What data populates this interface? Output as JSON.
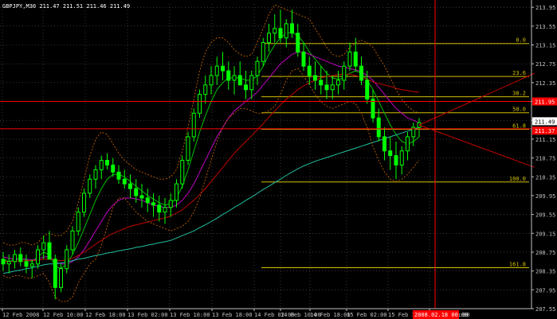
{
  "chart_data": {
    "type": "candlestick",
    "symbol_header": "GBPJPY,M30 211.47 211.51 211.46 211.49",
    "colors": {
      "background": "#000000",
      "grid": "#5a5a5a",
      "axis": "#c0c0c0",
      "candle": "#00ff00",
      "fib": "#d4c000",
      "redline": "#ff0000",
      "ma_green": "#00c000",
      "ma_magenta": "#c000c0",
      "ma_red": "#c00000",
      "ma_teal": "#20c0a0",
      "bollinger": "#c06000"
    },
    "ylim": [
      207.55,
      214.02
    ],
    "y_ticks": [
      "213.95",
      "213.55",
      "213.15",
      "212.75",
      "212.35",
      "211.95",
      "211.55",
      "211.15",
      "210.75",
      "210.35",
      "209.95",
      "209.55",
      "209.15",
      "208.75",
      "208.35",
      "207.95",
      "207.55"
    ],
    "x_ticks": [
      "12 Feb 2008",
      "12 Feb 10:00",
      "12 Feb 18:00",
      "13 Feb 02:00",
      "13 Feb 10:00",
      "13 Feb 18:00",
      "14 Feb 02:00",
      "14 Feb 10:00",
      "14 Feb 18:00",
      "15 Feb 02:00",
      "15 Feb 10:00",
      "15 Feb 18:00"
    ],
    "cursor_time_label": "2008.02.18 00:00",
    "current_price_label": "211.49",
    "red_price_label": "211.95",
    "red_price_label_2": "211.37",
    "fibonacci": {
      "levels": [
        {
          "label": "0.0",
          "price": 213.18
        },
        {
          "label": "23.6",
          "price": 212.48
        },
        {
          "label": "38.2",
          "price": 212.05
        },
        {
          "label": "50.0",
          "price": 211.71
        },
        {
          "label": "61.8",
          "price": 211.36
        },
        {
          "label": "100.0",
          "price": 210.24
        },
        {
          "label": "161.8",
          "price": 208.42
        }
      ]
    },
    "horizontal_lines": [
      211.95,
      211.37
    ],
    "series": [
      {
        "kind": "ohlc",
        "values": [
          [
            208.6,
            208.75,
            208.35,
            208.5
          ],
          [
            208.5,
            208.7,
            208.3,
            208.55
          ],
          [
            208.55,
            208.8,
            208.4,
            208.7
          ],
          [
            208.7,
            208.85,
            208.45,
            208.55
          ],
          [
            208.55,
            208.7,
            208.3,
            208.45
          ],
          [
            208.45,
            208.6,
            208.2,
            208.5
          ],
          [
            208.5,
            208.9,
            208.4,
            208.8
          ],
          [
            208.8,
            209.1,
            208.6,
            208.95
          ],
          [
            208.95,
            209.2,
            208.7,
            208.6
          ],
          [
            208.6,
            208.7,
            207.75,
            208.0
          ],
          [
            208.0,
            208.5,
            207.9,
            208.4
          ],
          [
            208.4,
            208.9,
            208.3,
            208.8
          ],
          [
            208.8,
            209.3,
            208.7,
            209.2
          ],
          [
            209.2,
            209.7,
            209.1,
            209.6
          ],
          [
            209.6,
            210.1,
            209.5,
            210.0
          ],
          [
            210.0,
            210.4,
            209.9,
            210.3
          ],
          [
            210.3,
            210.6,
            210.1,
            210.5
          ],
          [
            210.5,
            210.8,
            210.3,
            210.7
          ],
          [
            210.7,
            210.85,
            210.5,
            210.6
          ],
          [
            210.6,
            210.75,
            210.35,
            210.45
          ],
          [
            210.45,
            210.6,
            210.2,
            210.3
          ],
          [
            210.3,
            210.5,
            210.1,
            210.2
          ],
          [
            210.2,
            210.4,
            209.9,
            210.1
          ],
          [
            210.1,
            210.3,
            209.8,
            209.95
          ],
          [
            209.95,
            210.2,
            209.7,
            209.9
          ],
          [
            209.9,
            210.1,
            209.6,
            209.8
          ],
          [
            209.8,
            210.0,
            209.5,
            209.75
          ],
          [
            209.75,
            209.95,
            209.4,
            209.6
          ],
          [
            209.6,
            209.9,
            209.35,
            209.7
          ],
          [
            209.7,
            210.0,
            209.5,
            209.85
          ],
          [
            209.85,
            210.3,
            209.7,
            210.2
          ],
          [
            210.2,
            210.8,
            210.1,
            210.7
          ],
          [
            210.7,
            211.3,
            210.6,
            211.2
          ],
          [
            211.2,
            211.8,
            211.1,
            211.7
          ],
          [
            211.7,
            212.2,
            211.6,
            212.1
          ],
          [
            212.1,
            212.5,
            211.9,
            212.3
          ],
          [
            212.3,
            212.7,
            212.1,
            212.5
          ],
          [
            212.5,
            212.9,
            212.3,
            212.7
          ],
          [
            212.7,
            213.0,
            212.4,
            212.6
          ],
          [
            212.6,
            212.8,
            212.2,
            212.4
          ],
          [
            212.4,
            212.7,
            212.1,
            212.5
          ],
          [
            212.5,
            212.8,
            212.3,
            212.3
          ],
          [
            212.3,
            212.6,
            212.0,
            212.2
          ],
          [
            212.2,
            212.6,
            212.0,
            212.5
          ],
          [
            212.5,
            212.9,
            212.3,
            212.8
          ],
          [
            212.8,
            213.3,
            212.7,
            213.2
          ],
          [
            213.2,
            213.6,
            213.0,
            213.4
          ],
          [
            213.4,
            213.8,
            213.2,
            213.5
          ],
          [
            213.5,
            213.9,
            213.2,
            213.3
          ],
          [
            213.3,
            213.7,
            213.1,
            213.6
          ],
          [
            213.6,
            213.9,
            213.3,
            213.4
          ],
          [
            213.4,
            213.6,
            212.9,
            213.0
          ],
          [
            213.0,
            213.2,
            212.6,
            212.7
          ],
          [
            212.7,
            212.9,
            212.3,
            212.5
          ],
          [
            212.5,
            212.8,
            212.2,
            212.4
          ],
          [
            212.4,
            212.7,
            212.1,
            212.3
          ],
          [
            212.3,
            212.6,
            212.0,
            212.2
          ],
          [
            212.2,
            212.5,
            212.0,
            212.3
          ],
          [
            212.3,
            212.6,
            212.1,
            212.4
          ],
          [
            212.4,
            212.8,
            212.2,
            212.7
          ],
          [
            212.7,
            213.2,
            212.6,
            213.0
          ],
          [
            213.0,
            213.3,
            212.6,
            212.7
          ],
          [
            212.7,
            212.9,
            212.3,
            212.4
          ],
          [
            212.4,
            212.6,
            211.9,
            212.0
          ],
          [
            212.0,
            212.2,
            211.5,
            211.6
          ],
          [
            211.6,
            211.8,
            211.1,
            211.2
          ],
          [
            211.2,
            211.4,
            210.7,
            210.9
          ],
          [
            210.9,
            211.2,
            210.5,
            210.8
          ],
          [
            210.8,
            211.1,
            210.3,
            210.6
          ],
          [
            210.6,
            211.0,
            210.4,
            210.9
          ],
          [
            210.9,
            211.3,
            210.7,
            211.2
          ],
          [
            211.2,
            211.5,
            211.0,
            211.4
          ],
          [
            211.4,
            211.6,
            211.2,
            211.5
          ]
        ]
      },
      {
        "kind": "ma_green",
        "values": [
          208.6,
          208.55,
          208.6,
          208.62,
          208.58,
          208.55,
          208.65,
          208.75,
          208.7,
          208.45,
          208.4,
          208.5,
          208.7,
          208.95,
          209.25,
          209.55,
          209.85,
          210.1,
          210.3,
          210.4,
          210.4,
          210.35,
          210.25,
          210.15,
          210.05,
          209.95,
          209.88,
          209.8,
          209.75,
          209.78,
          209.9,
          210.15,
          210.5,
          210.9,
          211.3,
          211.65,
          211.95,
          212.2,
          212.35,
          212.45,
          212.45,
          212.45,
          212.4,
          212.4,
          212.5,
          212.7,
          212.95,
          213.15,
          213.3,
          213.4,
          213.42,
          213.35,
          213.2,
          213.0,
          212.85,
          212.7,
          212.55,
          212.45,
          212.42,
          212.45,
          212.55,
          212.6,
          212.55,
          212.4,
          212.2,
          211.95,
          211.7,
          211.45,
          211.25,
          211.1,
          211.05,
          211.1,
          211.2
        ]
      },
      {
        "kind": "ma_magenta",
        "values": [
          208.65,
          208.62,
          208.6,
          208.6,
          208.6,
          208.58,
          208.6,
          208.65,
          208.65,
          208.55,
          208.5,
          208.5,
          208.55,
          208.65,
          208.8,
          209.0,
          209.2,
          209.4,
          209.6,
          209.75,
          209.85,
          209.9,
          209.9,
          209.88,
          209.85,
          209.8,
          209.75,
          209.72,
          209.7,
          209.7,
          209.75,
          209.85,
          210.0,
          210.2,
          210.45,
          210.7,
          210.95,
          211.2,
          211.4,
          211.6,
          211.75,
          211.85,
          211.95,
          212.05,
          212.15,
          212.3,
          212.45,
          212.6,
          212.75,
          212.85,
          212.95,
          213.0,
          213.0,
          212.95,
          212.9,
          212.85,
          212.8,
          212.75,
          212.7,
          212.68,
          212.65,
          212.62,
          212.58,
          212.5,
          212.4,
          212.25,
          212.1,
          211.95,
          211.8,
          211.7,
          211.6,
          211.55,
          211.5
        ]
      },
      {
        "kind": "ma_red",
        "values": [
          208.55,
          208.55,
          208.56,
          208.56,
          208.57,
          208.57,
          208.58,
          208.6,
          208.6,
          208.58,
          208.57,
          208.58,
          208.62,
          208.68,
          208.75,
          208.83,
          208.92,
          209.0,
          209.08,
          209.15,
          209.2,
          209.25,
          209.3,
          209.33,
          209.36,
          209.39,
          209.42,
          209.45,
          209.48,
          209.52,
          209.58,
          209.65,
          209.75,
          209.85,
          209.97,
          210.1,
          210.25,
          210.4,
          210.55,
          210.7,
          210.85,
          210.98,
          211.1,
          211.22,
          211.35,
          211.48,
          211.62,
          211.75,
          211.88,
          212.0,
          212.1,
          212.2,
          212.28,
          212.35,
          212.4,
          212.45,
          212.48,
          212.5,
          212.52,
          212.53,
          212.53,
          212.5,
          212.47,
          212.42,
          212.37,
          212.33,
          212.3,
          212.27,
          212.23,
          212.2,
          212.18,
          212.16,
          212.15
        ]
      },
      {
        "kind": "ma_teal",
        "values": [
          208.3,
          208.32,
          208.35,
          208.37,
          208.4,
          208.42,
          208.45,
          208.48,
          208.5,
          208.5,
          208.52,
          208.54,
          208.57,
          208.6,
          208.62,
          208.65,
          208.68,
          208.7,
          208.73,
          208.75,
          208.78,
          208.8,
          208.82,
          208.85,
          208.87,
          208.9,
          208.92,
          208.95,
          208.97,
          209.0,
          209.05,
          209.1,
          209.15,
          209.2,
          209.27,
          209.33,
          209.4,
          209.47,
          209.55,
          209.62,
          209.7,
          209.77,
          209.85,
          209.92,
          210.0,
          210.08,
          210.15,
          210.23,
          210.3,
          210.38,
          210.45,
          210.52,
          210.58,
          210.63,
          210.68,
          210.72,
          210.76,
          210.8,
          210.84,
          210.88,
          210.92,
          210.96,
          211.0,
          211.04,
          211.08,
          211.12,
          211.16,
          211.2,
          211.24,
          211.28,
          211.32,
          211.36,
          211.4
        ]
      },
      {
        "kind": "bollinger_upper",
        "values": [
          208.95,
          208.9,
          208.9,
          208.95,
          208.95,
          208.9,
          208.95,
          209.1,
          209.15,
          209.1,
          209.1,
          209.2,
          209.4,
          209.8,
          210.3,
          210.8,
          211.15,
          211.3,
          211.25,
          211.05,
          210.85,
          210.7,
          210.6,
          210.5,
          210.45,
          210.4,
          210.35,
          210.3,
          210.3,
          210.35,
          210.5,
          210.9,
          211.4,
          212.0,
          212.6,
          213.0,
          213.2,
          213.3,
          213.3,
          213.2,
          213.05,
          212.95,
          212.9,
          212.95,
          213.2,
          213.5,
          213.8,
          214.0,
          213.95,
          213.9,
          213.85,
          213.8,
          213.75,
          213.7,
          213.5,
          213.3,
          213.1,
          212.95,
          212.9,
          212.95,
          213.1,
          213.2,
          213.25,
          213.2,
          213.1,
          212.9,
          212.7,
          212.45,
          212.2,
          212.0,
          211.85,
          211.75,
          211.7
        ]
      },
      {
        "kind": "bollinger_lower",
        "values": [
          208.25,
          208.2,
          208.25,
          208.25,
          208.2,
          208.2,
          208.25,
          208.3,
          208.1,
          207.8,
          207.7,
          207.7,
          207.8,
          208.1,
          208.3,
          208.5,
          208.6,
          208.9,
          209.3,
          209.7,
          209.9,
          209.9,
          209.75,
          209.6,
          209.5,
          209.4,
          209.35,
          209.3,
          209.25,
          209.2,
          209.25,
          209.3,
          209.4,
          209.6,
          209.9,
          210.3,
          210.7,
          211.1,
          211.4,
          211.6,
          211.7,
          211.8,
          211.8,
          211.75,
          211.7,
          211.7,
          211.75,
          211.85,
          212.1,
          212.4,
          212.6,
          212.65,
          212.5,
          212.3,
          212.1,
          211.95,
          211.85,
          211.8,
          211.85,
          211.9,
          211.95,
          211.9,
          211.7,
          211.4,
          211.0,
          210.7,
          210.45,
          210.3,
          210.25,
          210.3,
          210.4,
          210.55,
          210.7
        ]
      }
    ],
    "trendlines": [
      {
        "from": {
          "bar": 72,
          "price": 211.45
        },
        "to": {
          "bar": 92,
          "price": 212.55
        },
        "color": "#c00000"
      },
      {
        "from": {
          "bar": 72,
          "price": 211.45
        },
        "to": {
          "bar": 92,
          "price": 210.55
        },
        "color": "#c00000"
      }
    ]
  }
}
